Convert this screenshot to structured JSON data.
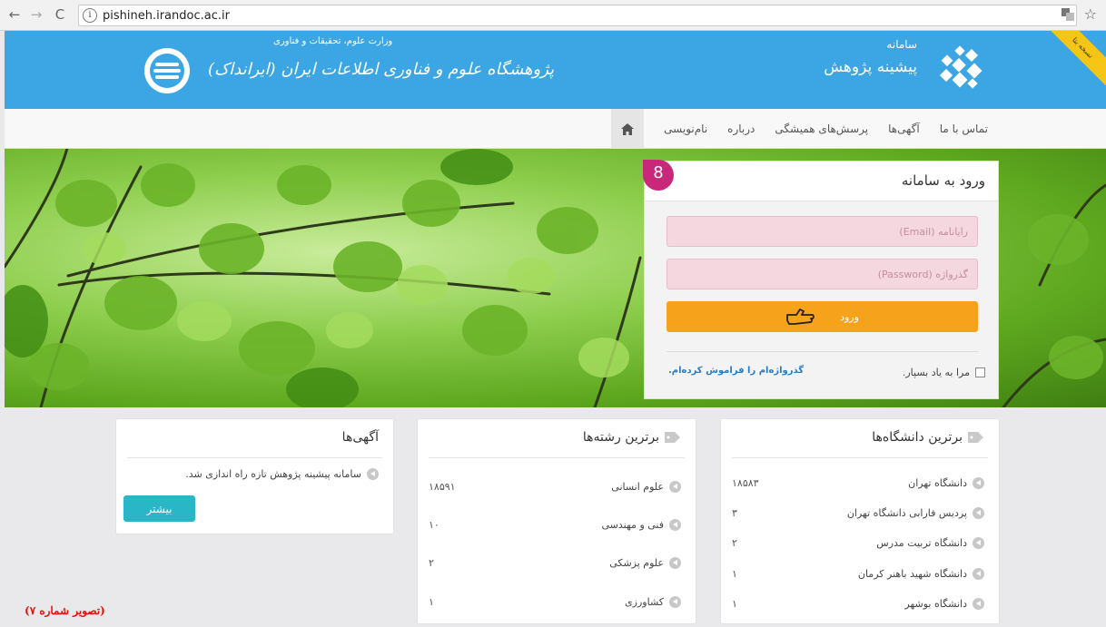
{
  "browser": {
    "url": "pishineh.irandoc.ac.ir",
    "info_icon": "i",
    "ext_icon": "translate-icon",
    "star_icon": "☆"
  },
  "header": {
    "site_pre": "سامانه",
    "site_name": "پیشینه پژوهش",
    "ribbon": "نسخه بتا",
    "ministry": "وزارت علوم، تحقیقات و فناوری",
    "institute": "پژوهشگاه علوم و فناوری اطلاعات ایران (ایرانداک)",
    "color": "#3ba6e3"
  },
  "menu": {
    "items": [
      "نام‌نویسی",
      "درباره",
      "پرسش‌های همیشگی",
      "آگهی‌ها",
      "تماس با ما"
    ]
  },
  "login": {
    "title": "ورود به سامانه",
    "badge": "8",
    "email_placeholder": "رایانامه (Email)",
    "password_placeholder": "گذرواژه (Password)",
    "submit_label": "ورود",
    "remember_label": "مرا به یاد بسپار.",
    "forgot_label": "گذرواژه‌ام را فراموش کرده‌ام."
  },
  "universities": {
    "title": "برترین دانشگاه‌ها",
    "rows": [
      {
        "label": "دانشگاه تهران",
        "value": "۱۸۵۸۳"
      },
      {
        "label": "پردیس فارابی دانشگاه تهران",
        "value": "۳"
      },
      {
        "label": "دانشگاه تربیت مدرس",
        "value": "۲"
      },
      {
        "label": "دانشگاه شهید باهنر کرمان",
        "value": "۱"
      },
      {
        "label": "دانشگاه بوشهر",
        "value": "۱"
      }
    ]
  },
  "fields": {
    "title": "برترین رشته‌ها",
    "rows": [
      {
        "label": "علوم انسانی",
        "value": "۱۸۵۹۱"
      },
      {
        "label": "فنی و مهندسی",
        "value": "۱۰"
      },
      {
        "label": "علوم پزشکی",
        "value": "۲"
      },
      {
        "label": "کشاورزی",
        "value": "۱"
      }
    ]
  },
  "news": {
    "title": "آگهی‌ها",
    "item": "سامانه پیشینه پژوهش تازه راه اندازی شد.",
    "more_label": "بیشتر"
  },
  "caption": "(تصویر شماره ۷)",
  "colors": {
    "login_button": "#f7a21b",
    "input_bg": "#f5d7df",
    "more_button": "#29b6c6",
    "caption": "#e0140d"
  }
}
